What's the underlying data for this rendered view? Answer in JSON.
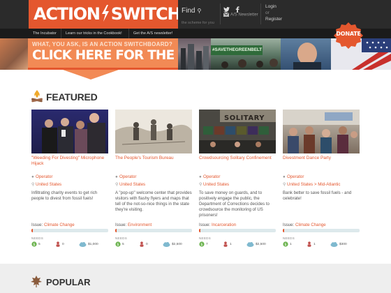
{
  "header": {
    "logo_text": "ACTION",
    "logo_text2": "SWITCHBOARD",
    "find_label": "Find",
    "find_sub": "the scheme for you",
    "newsletter": "A/S Newsletter",
    "login": "Login",
    "or": "or",
    "register": "Register"
  },
  "nav": {
    "items": [
      "The Incubator",
      "Learn our tricks in the Cookbook!",
      "Get the A/S newsletter!"
    ]
  },
  "banner": {
    "line1": "WHAT, YOU ASK, IS AN ACTION SWITCHBOARD?",
    "line2": "CLICK HERE FOR THE GRAND TOUR",
    "sign_text": "#SAVETHEGREENBELT",
    "donate": "DONATE"
  },
  "featured": {
    "title": "FEATURED",
    "labels": {
      "issue": "Issue:",
      "needs": "NEEDS"
    },
    "cards": [
      {
        "title": "\"Weeding For Divesting\" Microphone Hijack",
        "role": "Operator",
        "location": "United States",
        "description": "Infiltrating charity events to get rich people to divest from fossil fuels!",
        "issue": "Climate Change",
        "needs": [
          "5",
          "0",
          "$1,000"
        ]
      },
      {
        "title": "The People's Tourism Bureau",
        "role": "Operator",
        "location": "United States",
        "description": "A \"pop-up\" welcome center that provides visitors with flashy flyers and maps that tell of the not-so-nice things in the state they're visiting.",
        "issue": "Environment",
        "needs": [
          "5",
          "0",
          "$2,500"
        ]
      },
      {
        "title": "Crowdsourcing Solitary Confinement",
        "role": "Operator",
        "location": "United States",
        "image_text": "SOLITARY",
        "description": "To save money on guards, and to positively engage the public, the Department of Corrections decides to crowdsource the monitoring of US prisoners!",
        "issue": "Incarceration",
        "needs": [
          "7",
          "1",
          "$2,500"
        ]
      },
      {
        "title": "Divestment Dance Party",
        "role": "Operator",
        "location": "United States > Mid-Atlantic",
        "description": "Bank better to save fossil fuels - and celebrate!",
        "issue": "Climate Change",
        "needs": [
          "1",
          "1",
          "$300"
        ]
      }
    ]
  },
  "popular": {
    "title": "POPULAR"
  },
  "colors": {
    "brand": "#e4572e",
    "header_bg": "#2b2b2b",
    "nav_bg": "#1b1b1b",
    "needs_green": "#6cb34f",
    "needs_red": "#c0504d",
    "needs_blue": "#7fb9cf"
  }
}
